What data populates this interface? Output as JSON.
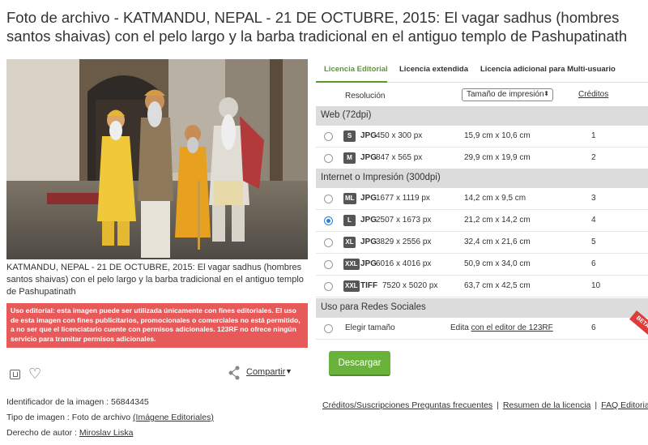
{
  "title": "Foto de archivo - KATMANDU, NEPAL - 21 DE OCTUBRE, 2015: El vagar sadhus (hombres santos shaivas) con el pelo largo y la barba tradicional en el antiguo templo de Pashupatinath",
  "caption": "KATMANDU, NEPAL - 21 DE OCTUBRE, 2015: El vagar sadhus (hombres santos shaivas) con el pelo largo y la barba tradicional en el antiguo templo de Pashupatinath",
  "editorial_notice": "Uso editorial: esta imagen puede ser utilizada únicamente con fines editoriales. El uso de esta imagen con fines publicitarios, promocionales o comerciales no está permitido, a no ser que el licenciatario cuente con permisos adicionales. 123RF no ofrece ningún servicio para tramitar permisos adicionales.",
  "share_label": "Compartir",
  "share_caret": "▼",
  "meta": {
    "id_label": "Identificador de la imagen : ",
    "id_value": "56844345",
    "type_label": "Tipo de imagen : Foto de archivo ",
    "type_value": "(Imágene Editoriales)",
    "author_label": "Derecho de autor : ",
    "author_value": "Miroslav Liska"
  },
  "tabs": [
    "Licencia Editorial",
    "Licencia extendida",
    "Licencia adicional para Multi-usuario"
  ],
  "header": {
    "resolution": "Resolución",
    "select_value": "Tamaño de impresión",
    "credits": "Créditos"
  },
  "sections": {
    "web": "Web (72dpi)",
    "print": "Internet o Impresión (300dpi)",
    "social": "Uso para Redes Sociales"
  },
  "rows": [
    {
      "badge": "S",
      "fmt": "JPG",
      "px": "450 x 300 px",
      "cm": "15,9 cm x 10,6 cm",
      "cr": "1",
      "selected": false
    },
    {
      "badge": "M",
      "fmt": "JPG",
      "px": "847 x 565 px",
      "cm": "29,9 cm x 19,9 cm",
      "cr": "2",
      "selected": false
    },
    {
      "badge": "ML",
      "fmt": "JPG",
      "px": "1677 x 1119 px",
      "cm": "14,2 cm x 9,5 cm",
      "cr": "3",
      "selected": false
    },
    {
      "badge": "L",
      "fmt": "JPG",
      "px": "2507 x 1673 px",
      "cm": "21,2 cm x 14,2 cm",
      "cr": "4",
      "selected": true
    },
    {
      "badge": "XL",
      "fmt": "JPG",
      "px": "3829 x 2556 px",
      "cm": "32,4 cm x 21,6 cm",
      "cr": "5",
      "selected": false
    },
    {
      "badge": "XXL",
      "fmt": "JPG",
      "px": "6016 x 4016 px",
      "cm": "50,9 cm x 34,0 cm",
      "cr": "6",
      "selected": false
    },
    {
      "badge": "XXL",
      "fmt": "TIFF",
      "px": "7520 x 5020 px",
      "cm": "63,7 cm x 42,5 cm",
      "cr": "10",
      "selected": false
    }
  ],
  "social": {
    "choose": "Elegir tamaño",
    "edit_prefix": "Edita ",
    "edit_link": "con el editor de 123RF",
    "credits": "6",
    "ribbon": "BETA"
  },
  "download_label": "Descargar",
  "footer": {
    "link1": "Créditos/Suscripciones Preguntas frecuentes",
    "link2": "Resumen de la licencia",
    "link3": "FAQ Editorial",
    "sep": "|"
  },
  "colors": {
    "accent_green": "#5b9a2a",
    "notice_red": "#e85a5a",
    "radio_blue": "#2e7fd3",
    "download_green": "#6ab33a"
  }
}
